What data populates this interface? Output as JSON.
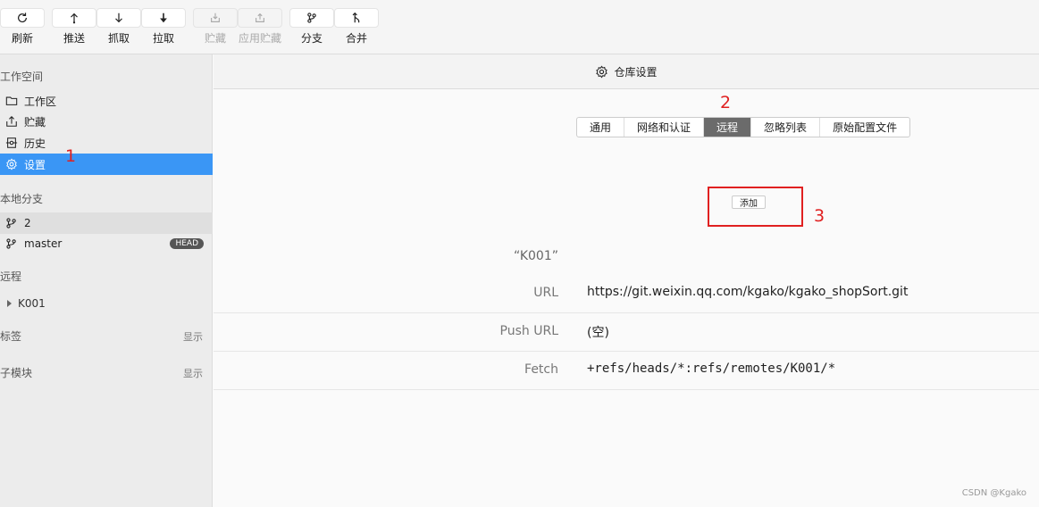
{
  "toolbar": {
    "buttons": [
      {
        "label": "刷新",
        "icon": "refresh-icon"
      },
      {
        "label": "推送",
        "icon": "push-icon"
      },
      {
        "label": "抓取",
        "icon": "fetch-icon"
      },
      {
        "label": "拉取",
        "icon": "pull-icon"
      },
      {
        "label": "贮藏",
        "icon": "stash-icon"
      },
      {
        "label": "应用贮藏",
        "icon": "apply-stash-icon"
      },
      {
        "label": "分支",
        "icon": "branch-icon"
      },
      {
        "label": "合并",
        "icon": "merge-icon"
      }
    ]
  },
  "sidebar": {
    "workspace_title": "工作空间",
    "workspace_items": [
      {
        "label": "工作区",
        "icon": "folder-icon"
      },
      {
        "label": "贮藏",
        "icon": "stash-icon"
      },
      {
        "label": "历史",
        "icon": "history-icon"
      },
      {
        "label": "设置",
        "icon": "gear-icon"
      }
    ],
    "local_branches_title": "本地分支",
    "branches": [
      {
        "label": "2"
      },
      {
        "label": "master",
        "badge": "HEAD"
      }
    ],
    "remotes_title": "远程",
    "remotes": [
      {
        "label": "K001"
      }
    ],
    "tags_title": "标签",
    "tags_toggle": "显示",
    "submodules_title": "子模块",
    "submodules_toggle": "显示"
  },
  "main": {
    "header_title": "仓库设置",
    "tabs": [
      "通用",
      "网络和认证",
      "远程",
      "忽略列表",
      "原始配置文件"
    ],
    "active_tab": "远程",
    "add_button": "添加",
    "remote_name": "“K001”",
    "rows": [
      {
        "key": "URL",
        "value": "https://git.weixin.qq.com/kgako/kgako_shopSort.git"
      },
      {
        "key": "Push URL",
        "value": "(空)"
      },
      {
        "key": "Fetch",
        "value": "+refs/heads/*:refs/remotes/K001/*"
      }
    ]
  },
  "annotations": {
    "a1": "1",
    "a2": "2",
    "a3": "3"
  },
  "watermark": "CSDN @Kgako",
  "colors": {
    "accent": "#3a96f5",
    "annotation": "#e02020",
    "active_tab": "#6b6b6b"
  }
}
